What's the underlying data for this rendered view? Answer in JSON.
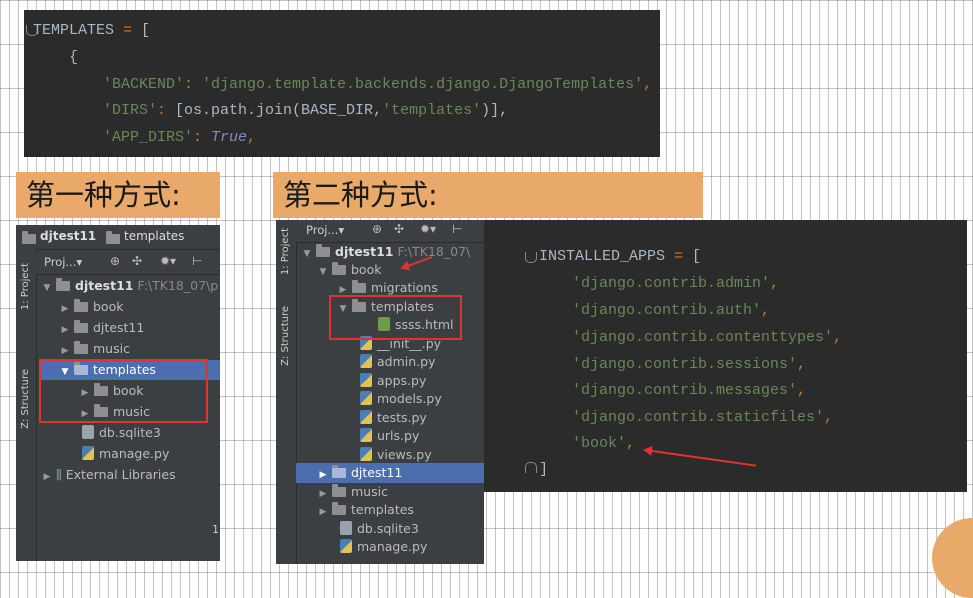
{
  "top_code": {
    "lines": [
      {
        "t": "TEMPLATES",
        "op": " = ",
        "rest": "["
      },
      {
        "t": "    {"
      },
      {
        "s1": "'BACKEND'",
        "colon": ": ",
        "s2": "'django.template.backends.django.DjangoTemplates'",
        "end": ","
      },
      {
        "s1": "'DIRS'",
        "colon": ": ",
        "mid": "[os.path.join(BASE_DIR,",
        "s2": "'templates'",
        "end": ")],"
      },
      {
        "s1": "'APP_DIRS'",
        "colon": ": ",
        "val": "True",
        "end": ","
      }
    ]
  },
  "left_label": "第一种方式:",
  "right_label": "第二种方式:",
  "left_ide": {
    "title_project": "djtest11",
    "title_folder": "templates",
    "tab_project": "1: Project",
    "tab_structure": "Z: Structure",
    "toolbar_label": "Proj...",
    "root": "djtest11",
    "root_path": "F:\\TK18_07\\p",
    "items": [
      "book",
      "djtest11",
      "music",
      "templates",
      "book",
      "music",
      "db.sqlite3",
      "manage.py",
      "External Libraries"
    ],
    "line_marker": "1"
  },
  "right_ide": {
    "tab_project": "1: Project",
    "tab_structure": "Z: Structure",
    "toolbar_label": "Proj...",
    "root": "djtest11",
    "root_path": "F:\\TK18_07\\",
    "items": [
      "book",
      "migrations",
      "templates",
      "ssss.html",
      "__init__.py",
      "admin.py",
      "apps.py",
      "models.py",
      "tests.py",
      "urls.py",
      "views.py",
      "djtest11",
      "music",
      "templates",
      "db.sqlite3",
      "manage.py"
    ]
  },
  "apps_code": {
    "head": "INSTALLED_APPS",
    "op": " = ",
    "open": "[",
    "apps": [
      "'django.contrib.admin'",
      "'django.contrib.auth'",
      "'django.contrib.contenttypes'",
      "'django.contrib.sessions'",
      "'django.contrib.messages'",
      "'django.contrib.staticfiles'",
      "'book'"
    ],
    "comma": ",",
    "close": "]"
  },
  "colors": {
    "editor_bg": "#2b2b2b",
    "ide_bg": "#3c3f41",
    "accent_orange": "#e8a96b",
    "annotation_red": "#e0322f",
    "selection": "#4b6eaf"
  }
}
